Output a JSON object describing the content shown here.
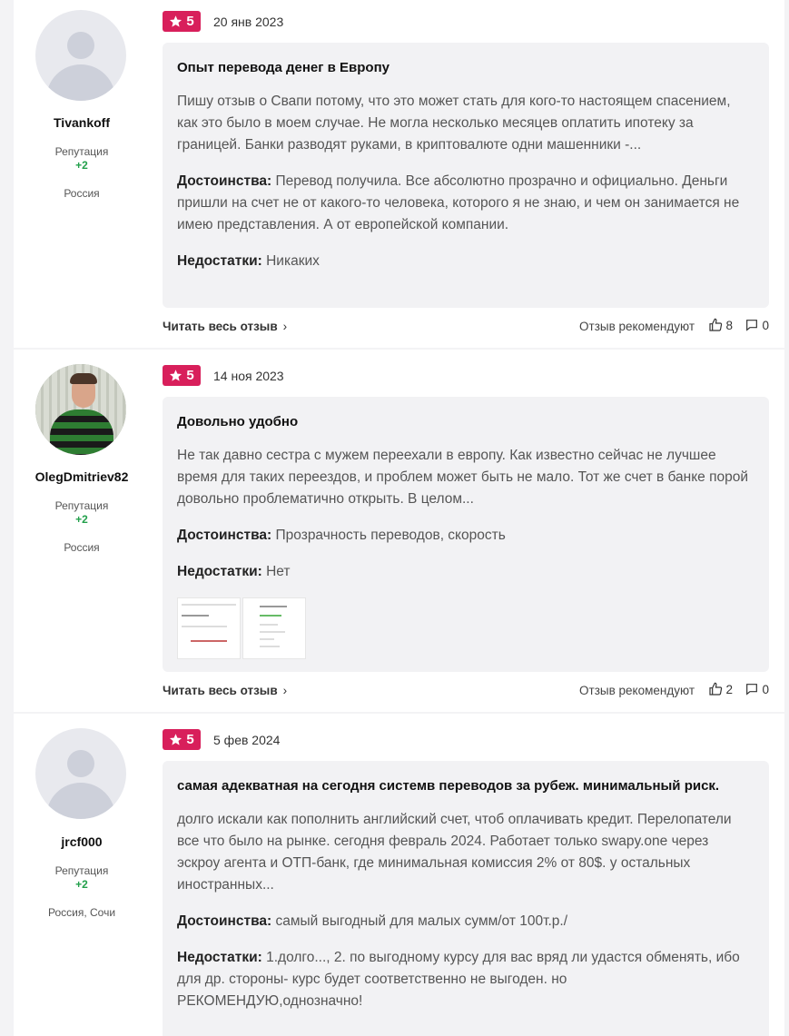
{
  "reviews": [
    {
      "author": {
        "nick": "Tivankoff",
        "rep_label": "Репутация",
        "rep_value": "+2",
        "city": "Россия",
        "avatar": "default-avatar-icon"
      },
      "rating": "5",
      "date": "20 янв 2023",
      "title": "Опыт перевода денег в Европу",
      "text": "Пишу отзыв о Свапи потому, что это может стать для кого-то настоящем спасением, как это было в моем случае. Не могла несколько месяцев оплатить ипотеку за границей. Банки разводят руками, в криптовалюте одни машенники -...",
      "pros_label": "Достоинства:",
      "pros": "Перевод получила. Все абсолютно прозрачно и официально. Деньги пришли на счет не от какого-то человека, которого я не знаю, и чем он занимается не имею представления. А от европейской компании.",
      "cons_label": "Недостатки:",
      "cons": "Никаких",
      "read_more": "Читать весь отзыв",
      "recommend_label": "Отзыв рекомендуют",
      "likes": "8",
      "comments": "0"
    },
    {
      "author": {
        "nick": "OlegDmitriev82",
        "rep_label": "Репутация",
        "rep_value": "+2",
        "city": "Россия",
        "avatar": "user-photo"
      },
      "rating": "5",
      "date": "14 ноя 2023",
      "title": "Довольно удобно",
      "text": "Не так давно сестра с мужем переехали в европу. Как известно сейчас не лучшее время для таких переездов, и проблем может быть не мало. Тот же счет в банке порой довольно проблематично открыть. В целом...",
      "pros_label": "Достоинства:",
      "pros": "Прозрачность переводов, скорость",
      "cons_label": "Недостатки:",
      "cons": "Нет",
      "read_more": "Читать весь отзыв",
      "recommend_label": "Отзыв рекомендуют",
      "likes": "2",
      "comments": "0"
    },
    {
      "author": {
        "nick": "jrcf000",
        "rep_label": "Репутация",
        "rep_value": "+2",
        "city": "Россия, Сочи",
        "avatar": "default-avatar-icon"
      },
      "rating": "5",
      "date": "5 фев 2024",
      "title": "самая адекватная на сегодня системв переводов за рубеж. минимальный риск.",
      "text": "долго искали как пополнить английский счет, чтоб оплачивать кредит. Перелопатели все что было на рынке. сегодня февраль 2024. Работает только swapy.one через эскроу агента и ОТП-банк, где минимальная комиссия 2% от 80$. у остальных иностранных...",
      "pros_label": "Достоинства:",
      "pros": "самый выгодный для малых сумм/от 100т.р./",
      "cons_label": "Недостатки:",
      "cons": "1.долго..., 2. по выгодному курсу для вас вряд ли удастся обменять, ибо для др. стороны- курс будет соответственно не выгоден. но РЕКОМЕНДУЮ,однозначно!"
    }
  ],
  "colors": {
    "badge": "#d81f5b",
    "reputation": "#22a04b",
    "card": "#f2f2f4"
  }
}
